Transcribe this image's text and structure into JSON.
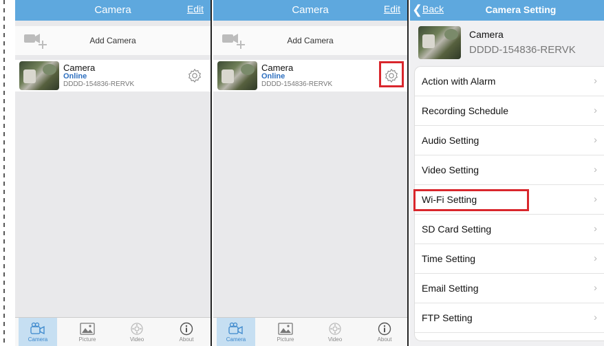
{
  "screen1": {
    "title": "Camera",
    "edit_label": "Edit",
    "add_camera_label": "Add Camera",
    "camera": {
      "name": "Camera",
      "status": "Online",
      "id": "DDDD-154836-RERVK"
    },
    "tabs": [
      {
        "label": "Camera",
        "icon": "camera-icon",
        "active": true
      },
      {
        "label": "Picture",
        "icon": "picture-icon",
        "active": false
      },
      {
        "label": "Video",
        "icon": "video-icon",
        "active": false
      },
      {
        "label": "About",
        "icon": "info-icon",
        "active": false
      }
    ]
  },
  "screen2": {
    "title": "Camera",
    "edit_label": "Edit",
    "add_camera_label": "Add Camera",
    "camera": {
      "name": "Camera",
      "status": "Online",
      "id": "DDDD-154836-RERVK"
    },
    "tabs": [
      {
        "label": "Camera",
        "icon": "camera-icon",
        "active": true
      },
      {
        "label": "Picture",
        "icon": "picture-icon",
        "active": false
      },
      {
        "label": "Video",
        "icon": "video-icon",
        "active": false
      },
      {
        "label": "About",
        "icon": "info-icon",
        "active": false
      }
    ]
  },
  "screen3": {
    "back_label": "Back",
    "title": "Camera Setting",
    "camera": {
      "name": "Camera",
      "id": "DDDD-154836-RERVK"
    },
    "settings": [
      {
        "label": "Action with Alarm"
      },
      {
        "label": "Recording Schedule"
      },
      {
        "label": "Audio Setting"
      },
      {
        "label": "Video Setting"
      },
      {
        "label": "Wi-Fi Setting",
        "highlighted": true
      },
      {
        "label": "SD Card Setting"
      },
      {
        "label": "Time Setting"
      },
      {
        "label": "Email Setting"
      },
      {
        "label": "FTP Setting"
      }
    ]
  },
  "colors": {
    "navbar": "#5ea8de",
    "highlight": "#d9262c",
    "status": "#2d6fbf",
    "tab_active": "#c6dff2"
  }
}
